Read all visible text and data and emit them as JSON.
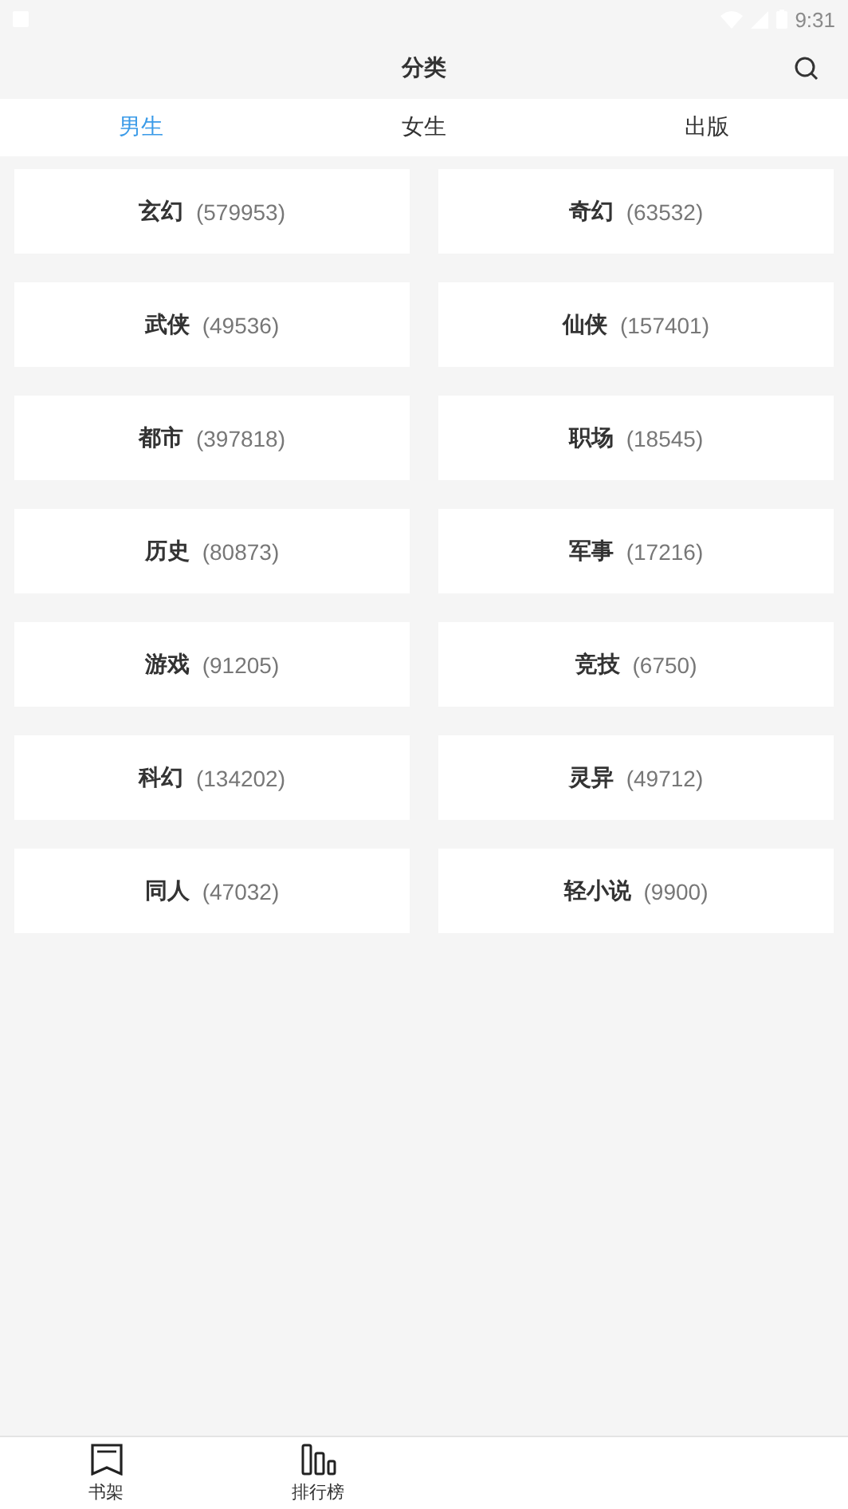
{
  "status_bar": {
    "time": "9:31"
  },
  "header": {
    "title": "分类"
  },
  "tabs": [
    {
      "label": "男生",
      "selected": true
    },
    {
      "label": "女生",
      "selected": false
    },
    {
      "label": "出版",
      "selected": false
    }
  ],
  "categories": [
    {
      "name": "玄幻",
      "count": "(579953)"
    },
    {
      "name": "奇幻",
      "count": "(63532)"
    },
    {
      "name": "武侠",
      "count": "(49536)"
    },
    {
      "name": "仙侠",
      "count": "(157401)"
    },
    {
      "name": "都市",
      "count": "(397818)"
    },
    {
      "name": "职场",
      "count": "(18545)"
    },
    {
      "name": "历史",
      "count": "(80873)"
    },
    {
      "name": "军事",
      "count": "(17216)"
    },
    {
      "name": "游戏",
      "count": "(91205)"
    },
    {
      "name": "竞技",
      "count": "(6750)"
    },
    {
      "name": "科幻",
      "count": "(134202)"
    },
    {
      "name": "灵异",
      "count": "(49712)"
    },
    {
      "name": "同人",
      "count": "(47032)"
    },
    {
      "name": "轻小说",
      "count": "(9900)"
    }
  ],
  "bottom_nav": [
    {
      "label": "书架",
      "kind": "shelf"
    },
    {
      "label": "排行榜",
      "kind": "ranking"
    }
  ]
}
